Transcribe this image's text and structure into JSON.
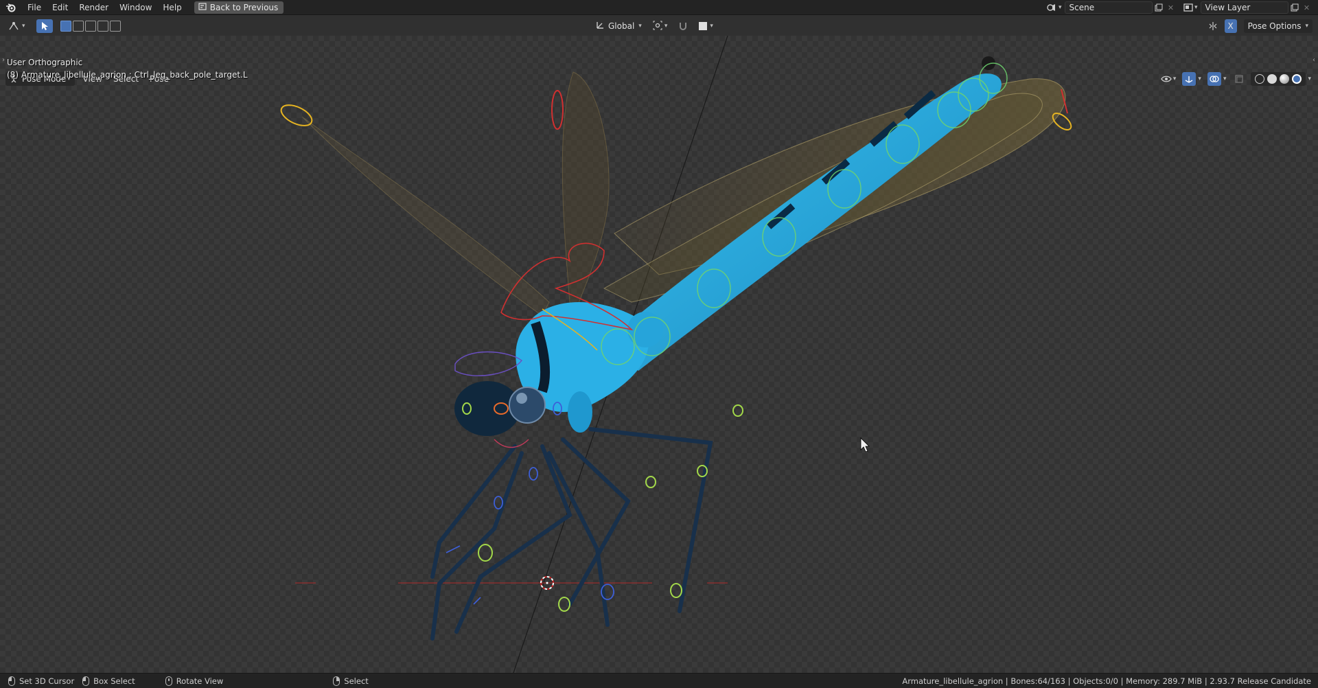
{
  "topbar": {
    "menus": [
      "File",
      "Edit",
      "Render",
      "Window",
      "Help"
    ],
    "back_button": "Back to Previous",
    "scene_name": "Scene",
    "view_layer": "View Layer"
  },
  "header": {
    "transform_orientation": "Global",
    "pose_options": "Pose Options",
    "x_mirror": "X",
    "mode": "Pose Mode",
    "menus": [
      "View",
      "Select",
      "Pose"
    ]
  },
  "viewport": {
    "view_name": "User Orthographic",
    "active_info": "(8) Armature_libellule_agrion : Ctrl_leg_back_pole_target.L"
  },
  "status": {
    "left_click": "Set 3D Cursor",
    "left_drag": "Box Select",
    "middle": "Rotate View",
    "right": "Select",
    "stats": "Armature_libellule_agrion | Bones:64/163 | Objects:0/0 | Memory: 289.7 MiB | 2.93.7 Release Candidate"
  },
  "colors": {
    "accent": "#4772b3",
    "body_blue": "#2aa8de",
    "bone_green": "#6fd36f",
    "bone_red": "#d03030",
    "bone_yellow": "#e6b422",
    "bone_blue": "#3d5fd8"
  },
  "icons": [
    "blender-logo-icon",
    "back-icon",
    "scene-icon",
    "view-layer-icon",
    "editor-type-icon",
    "select-tool-icon",
    "orientation-icon",
    "snap-icon",
    "proportional-icon",
    "visibility-icon",
    "gizmo-icon",
    "overlay-icon",
    "xray-icon",
    "wireframe-shading-icon",
    "solid-shading-icon",
    "material-shading-icon",
    "rendered-shading-icon",
    "cursor-icon"
  ]
}
